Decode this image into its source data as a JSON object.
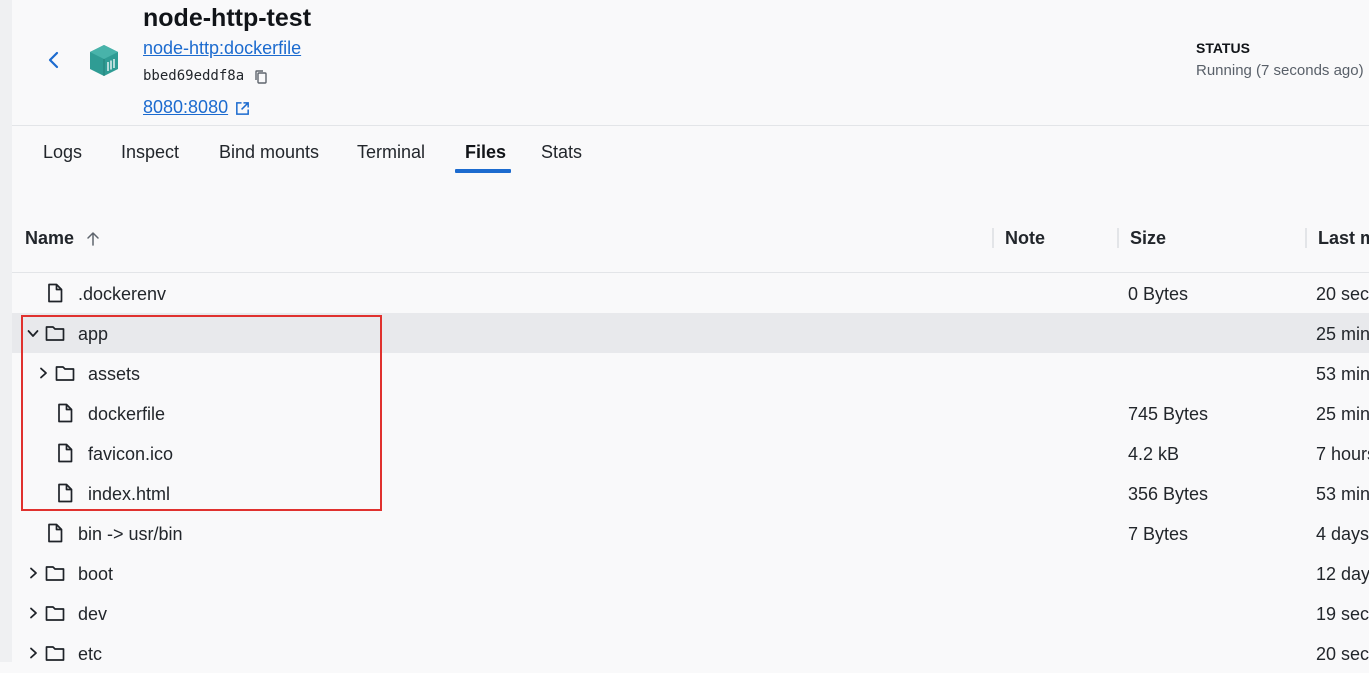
{
  "header": {
    "title": "node-http-test",
    "image_link": "node-http:dockerfile",
    "container_id": "bbed69eddf8a",
    "port_link": "8080:8080",
    "status_label": "STATUS",
    "status_value": "Running (7 seconds ago)"
  },
  "tabs": [
    {
      "label": "Logs"
    },
    {
      "label": "Inspect"
    },
    {
      "label": "Bind mounts"
    },
    {
      "label": "Terminal"
    },
    {
      "label": "Files",
      "active": true
    },
    {
      "label": "Stats"
    }
  ],
  "table": {
    "columns": {
      "name": "Name",
      "note": "Note",
      "size": "Size",
      "modified": "Last m"
    },
    "rows": [
      {
        "name": ".dockerenv",
        "type": "file",
        "size": "0 Bytes",
        "modified": "20 sec",
        "level": 0
      },
      {
        "name": "app",
        "type": "folder",
        "expanded": true,
        "size": "",
        "modified": "25 min",
        "level": 0,
        "selected": true
      },
      {
        "name": "assets",
        "type": "folder",
        "expanded": false,
        "size": "",
        "modified": "53 min",
        "level": 1
      },
      {
        "name": "dockerfile",
        "type": "file",
        "size": "745 Bytes",
        "modified": "25 min",
        "level": 1
      },
      {
        "name": "favicon.ico",
        "type": "file",
        "size": "4.2 kB",
        "modified": "7 hours",
        "level": 1
      },
      {
        "name": "index.html",
        "type": "file",
        "size": "356 Bytes",
        "modified": "53 min",
        "level": 1
      },
      {
        "name": "bin -> usr/bin",
        "type": "file",
        "size": "7 Bytes",
        "modified": "4 days",
        "level": 0
      },
      {
        "name": "boot",
        "type": "folder",
        "expanded": false,
        "size": "",
        "modified": "12 day",
        "level": 0
      },
      {
        "name": "dev",
        "type": "folder",
        "expanded": false,
        "size": "",
        "modified": "19 sec",
        "level": 0
      },
      {
        "name": "etc",
        "type": "folder",
        "expanded": false,
        "size": "",
        "modified": "20 sec",
        "level": 0
      }
    ]
  },
  "icons": {
    "back": "chevron-left-icon",
    "container": "container-icon",
    "copy": "copy-icon",
    "external": "external-link-icon",
    "sort": "arrow-up-icon",
    "file": "file-icon",
    "folder": "folder-icon"
  },
  "colors": {
    "accent": "#1c6bcf",
    "container_icon": "#2f9c94",
    "highlight_box": "#e0312e",
    "selected_row": "#e8e9ec"
  }
}
